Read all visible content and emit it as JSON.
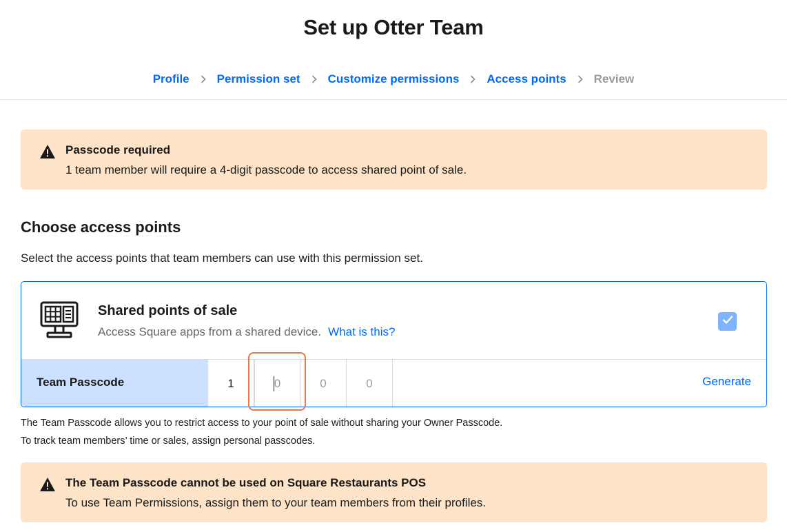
{
  "header": {
    "title": "Set up Otter Team"
  },
  "breadcrumb": {
    "items": [
      {
        "label": "Profile",
        "active": true
      },
      {
        "label": "Permission set",
        "active": true
      },
      {
        "label": "Customize permissions",
        "active": true
      },
      {
        "label": "Access points",
        "active": true
      },
      {
        "label": "Review",
        "active": false
      }
    ]
  },
  "alerts": {
    "passcode": {
      "icon": "warning-icon",
      "title": "Passcode required",
      "text": "1 team member will require a 4-digit passcode to access shared point of sale."
    },
    "restaurants": {
      "icon": "warning-icon",
      "title": "The Team Passcode cannot be used on Square Restaurants POS",
      "text": "To use Team Permissions, assign them to your team members from their profiles."
    }
  },
  "section": {
    "title": "Choose access points",
    "description": "Select the access points that team members can use with this permission set."
  },
  "access_point": {
    "icon": "pos-terminal-icon",
    "title": "Shared points of sale",
    "description": "Access Square apps from a shared device.",
    "link": "What is this?",
    "checked": true
  },
  "team_passcode": {
    "label": "Team Passcode",
    "digits": [
      {
        "value": "1",
        "placeholder": "0"
      },
      {
        "value": "",
        "placeholder": "0"
      },
      {
        "value": "",
        "placeholder": "0"
      },
      {
        "value": "",
        "placeholder": "0"
      }
    ],
    "generate_label": "Generate"
  },
  "notes": {
    "line1": "The Team Passcode allows you to restrict access to your point of sale without sharing your Owner Passcode.",
    "line2": "To track team members’ time or sales, assign personal passcodes."
  },
  "colors": {
    "accent": "#006aff",
    "banner_bg": "#fde3c8",
    "passcode_label_bg": "#cce1ff",
    "focus_ring": "#e8784a",
    "checkbox_bg": "#80b3ff"
  }
}
